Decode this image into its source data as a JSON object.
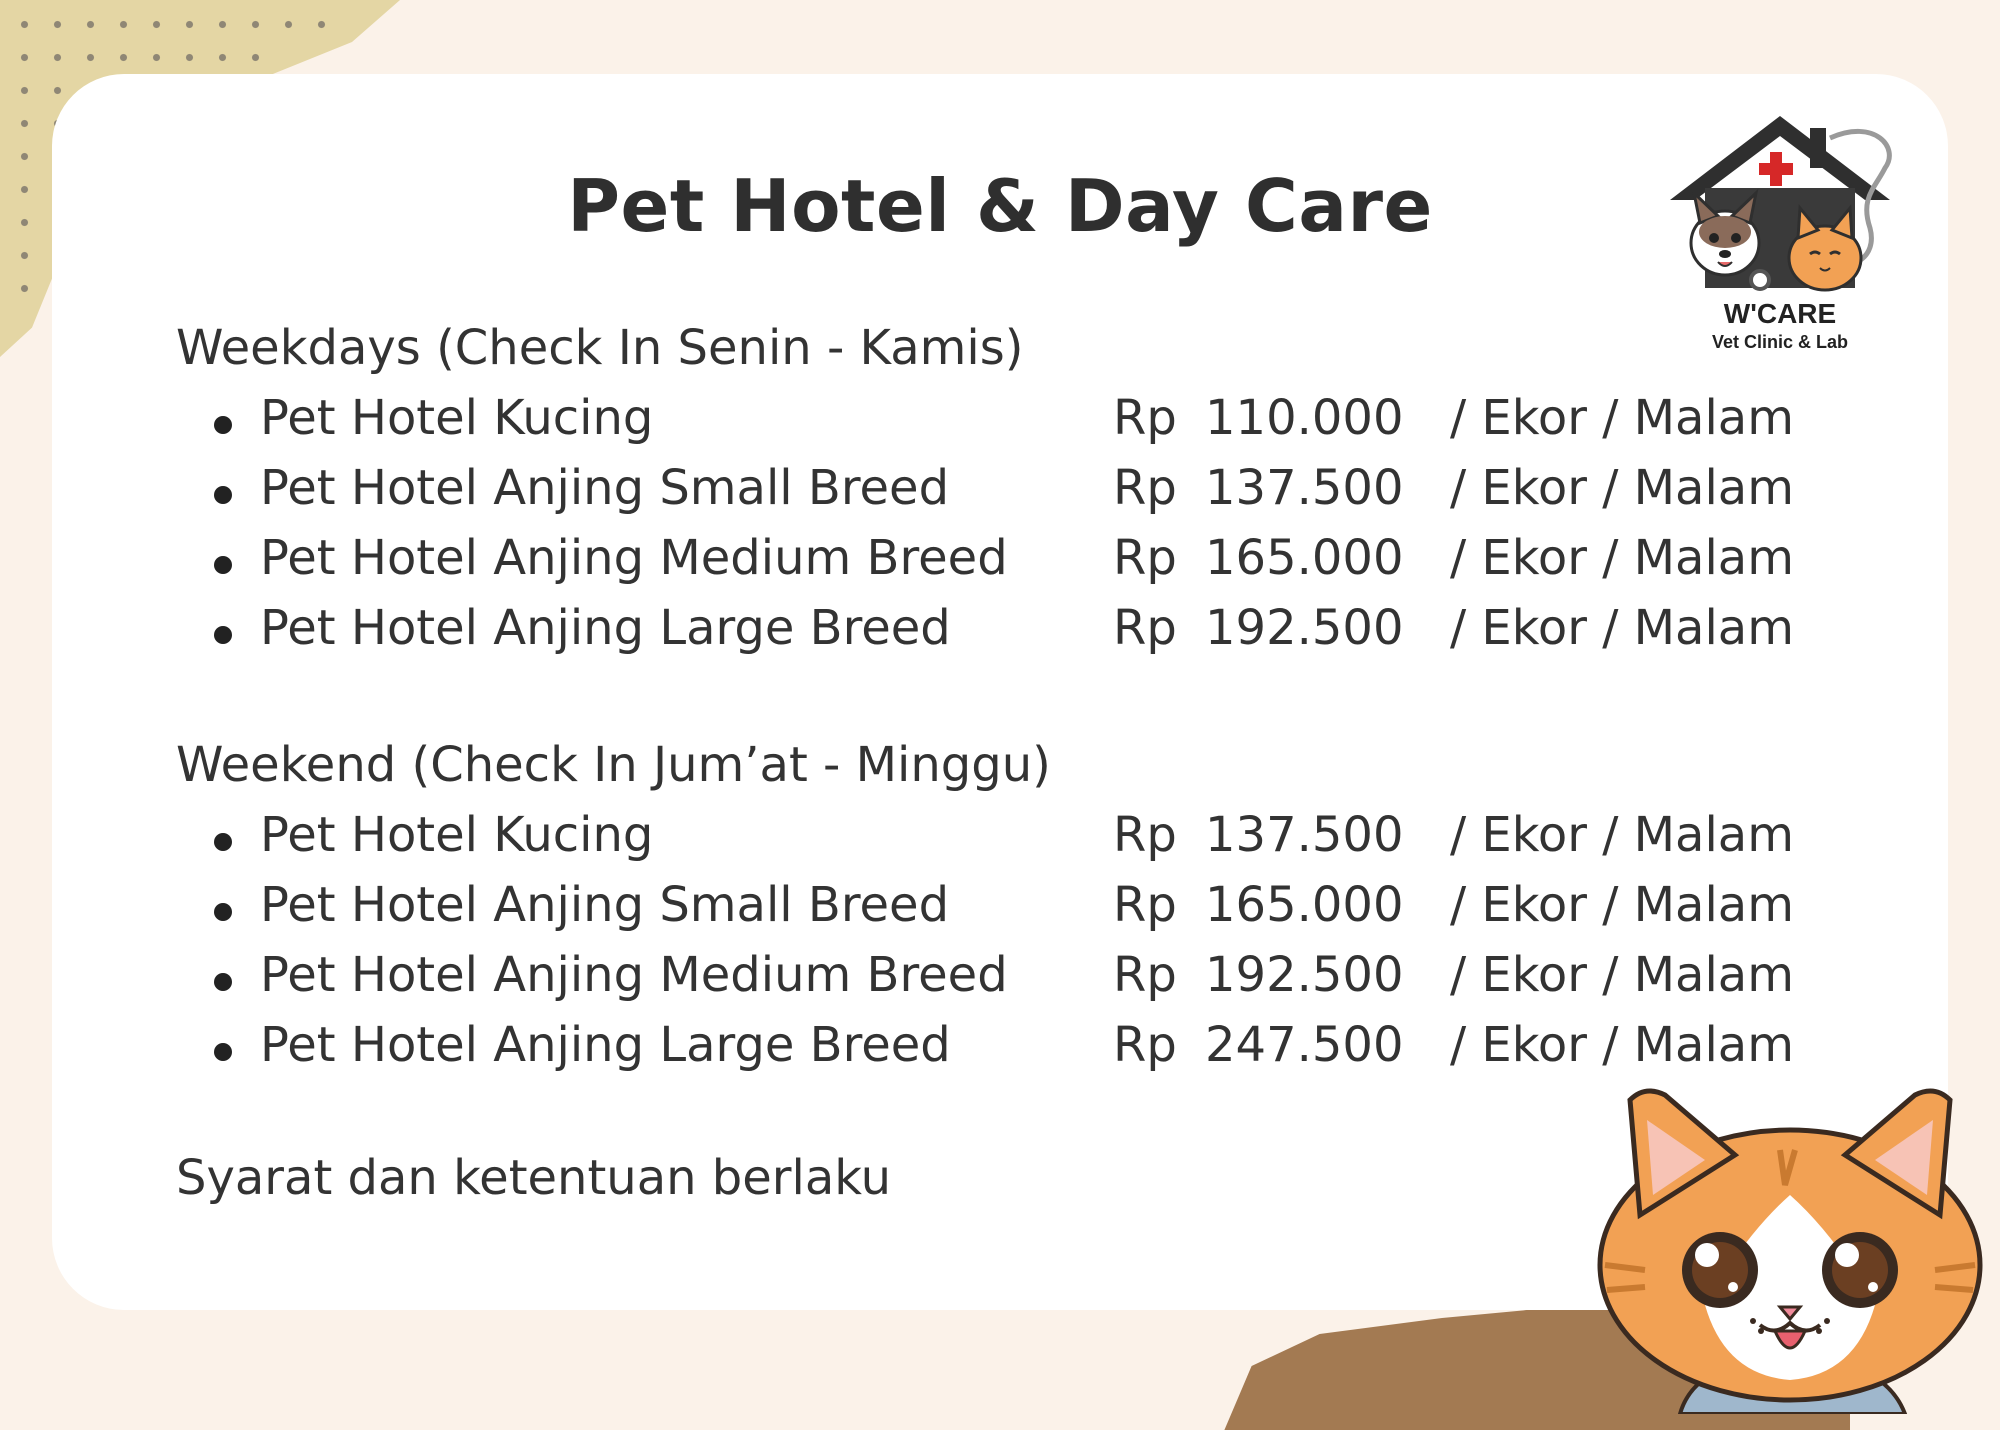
{
  "title": "Pet Hotel & Day Care",
  "logo": {
    "name": "W'CARE",
    "subtitle": "Vet Clinic & Lab"
  },
  "weekdays": {
    "heading": "Weekdays (Check In Senin - Kamis)",
    "items": [
      {
        "label": "Pet Hotel Kucing",
        "currency": "Rp",
        "price": "110.000",
        "unit": "/ Ekor / Malam"
      },
      {
        "label": "Pet Hotel Anjing Small Breed",
        "currency": "Rp",
        "price": "137.500",
        "unit": "/ Ekor / Malam"
      },
      {
        "label": "Pet Hotel Anjing Medium Breed",
        "currency": "Rp",
        "price": "165.000",
        "unit": "/ Ekor / Malam"
      },
      {
        "label": "Pet Hotel Anjing Large Breed",
        "currency": "Rp",
        "price": "192.500",
        "unit": "/ Ekor / Malam"
      }
    ]
  },
  "weekend": {
    "heading": "Weekend (Check In Jum’at - Minggu)",
    "items": [
      {
        "label": "Pet Hotel Kucing",
        "currency": "Rp",
        "price": "137.500",
        "unit": "/ Ekor / Malam"
      },
      {
        "label": "Pet Hotel Anjing Small Breed",
        "currency": "Rp",
        "price": "165.000",
        "unit": "/ Ekor / Malam"
      },
      {
        "label": "Pet Hotel Anjing Medium Breed",
        "currency": "Rp",
        "price": "192.500",
        "unit": "/ Ekor / Malam"
      },
      {
        "label": "Pet Hotel Anjing Large Breed",
        "currency": "Rp",
        "price": "247.500",
        "unit": "/ Ekor / Malam"
      }
    ]
  },
  "note": "Syarat dan ketentuan berlaku",
  "colors": {
    "background": "#fbf2e9",
    "card": "#ffffff",
    "text": "#333333",
    "accent_red": "#d62828",
    "cat_orange": "#f2a154"
  }
}
